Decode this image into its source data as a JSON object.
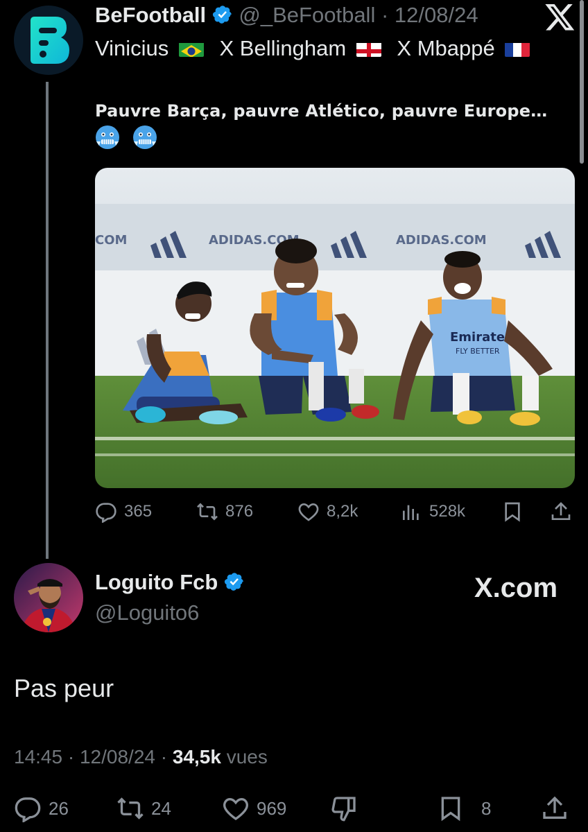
{
  "original_tweet": {
    "author_name": "BeFootball",
    "author_handle": "@_BeFootball",
    "separator": "·",
    "date": "12/08/24",
    "line1": {
      "player1": "Vinicius",
      "x1": "X Bellingham",
      "x2": "X Mbappé"
    },
    "line2": "Pauvre Barça, pauvre Atlético, pauvre Europe…",
    "emojis": [
      "cold-face",
      "cold-face"
    ],
    "photo_ad_text": [
      "ADIDAS.COM",
      "ADIDAS.COM",
      "COM"
    ],
    "photo_shirt_text": [
      "Emirates",
      "FLY BETTER"
    ],
    "stats": {
      "replies": "365",
      "reposts": "876",
      "likes": "8,2k",
      "views": "528k"
    }
  },
  "reply": {
    "author_name": "Loguito Fcb",
    "author_handle": "@Loguito6",
    "brand": "X.com",
    "text": "Pas peur",
    "time": "14:45",
    "date": "12/08/24",
    "views_count": "34,5k",
    "views_label": "vues",
    "sep": "·",
    "stats": {
      "replies": "26",
      "reposts": "24",
      "likes": "969",
      "bookmarks": "8"
    }
  },
  "colors": {
    "background": "#000000",
    "text": "#e7e9ea",
    "muted": "#71767b",
    "verified": "#1d9bf0",
    "befootball_logo": "#19d6c6"
  },
  "icons": [
    "reply-icon",
    "repost-icon",
    "like-icon",
    "views-icon",
    "bookmark-icon",
    "share-icon",
    "dislike-icon",
    "x-logo-icon",
    "verified-badge-icon"
  ]
}
